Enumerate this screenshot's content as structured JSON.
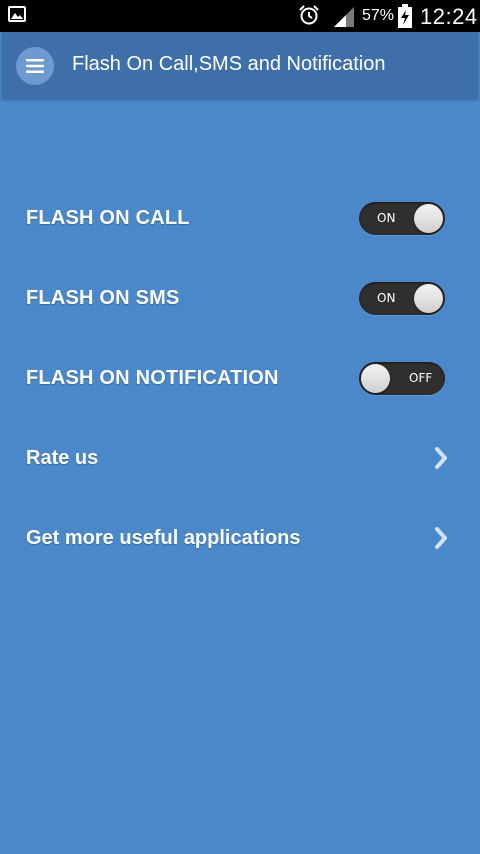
{
  "status_bar": {
    "battery_percent": "57%",
    "time": "12:24",
    "icons": [
      "gallery-icon",
      "alarm-icon",
      "signal-icon",
      "battery-charging-icon"
    ]
  },
  "app_bar": {
    "title": "Flash On Call,SMS and Notification",
    "menu_icon": "hamburger-menu-icon"
  },
  "settings": [
    {
      "label": "FLASH ON CALL",
      "toggle": "ON",
      "enabled": true
    },
    {
      "label": "FLASH ON SMS",
      "toggle": "ON",
      "enabled": true
    },
    {
      "label": "FLASH ON NOTIFICATION",
      "toggle": "OFF",
      "enabled": false
    }
  ],
  "links": [
    {
      "label": "Rate us",
      "icon": "chevron-right-icon"
    },
    {
      "label": "Get more useful applications",
      "icon": "chevron-right-icon"
    }
  ],
  "colors": {
    "background": "#4a88ca",
    "app_bar": "#3e6fa9",
    "toggle_track": "#2f2f2f",
    "chevron": "#cfe0f3"
  }
}
